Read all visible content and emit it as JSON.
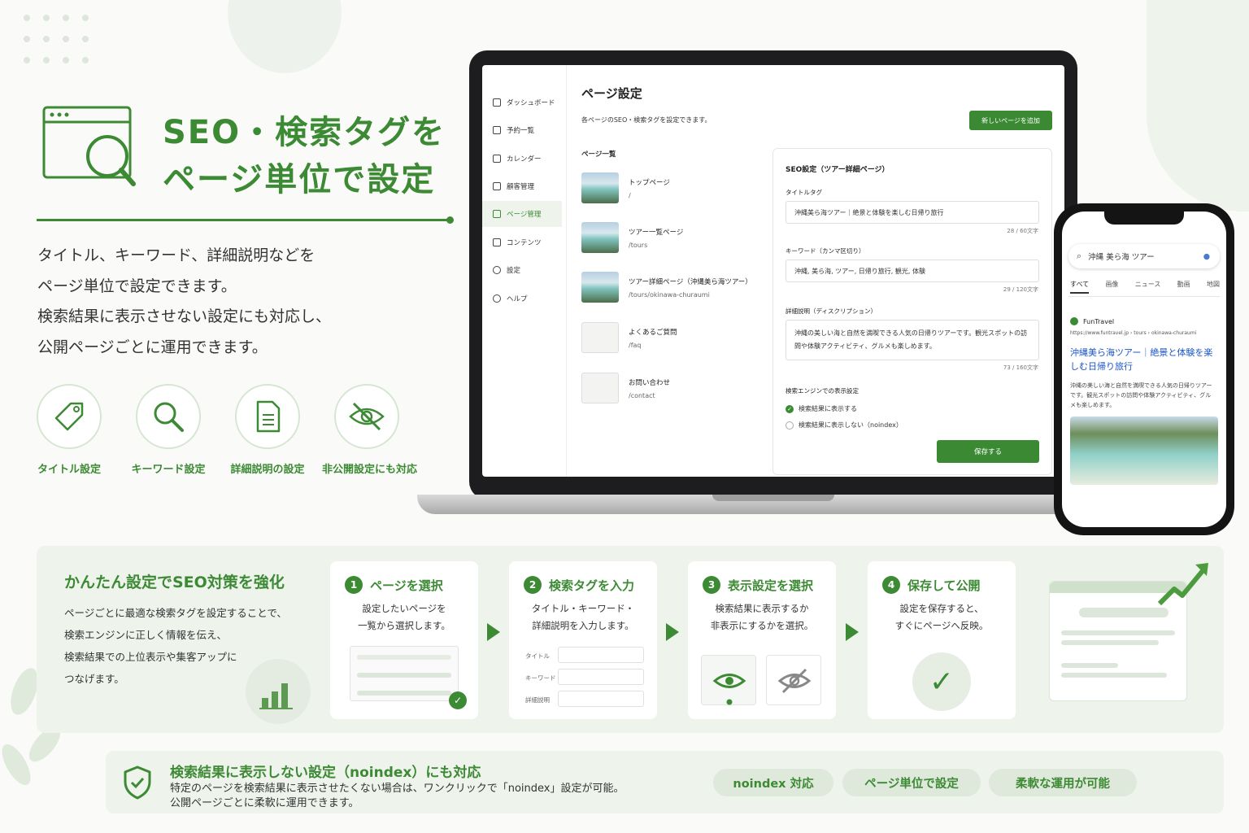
{
  "hero": {
    "title_line1": "SEO・検索タグを",
    "title_line2": "ページ単位で設定",
    "desc": [
      "タイトル、キーワード、詳細説明などを",
      "ページ単位で設定できます。",
      "検索結果に表示させない設定にも対応し、",
      "公開ページごとに運用できます。"
    ]
  },
  "features": [
    {
      "label": "タイトル設定",
      "icon": "tag-icon"
    },
    {
      "label": "キーワード設定",
      "icon": "search-icon"
    },
    {
      "label": "詳細説明の設定",
      "icon": "document-icon"
    },
    {
      "label": "非公開設定にも対応",
      "icon": "eye-off-icon"
    }
  ],
  "app": {
    "sidebar": [
      "ダッシュボード",
      "予約一覧",
      "カレンダー",
      "顧客管理",
      "ページ管理",
      "コンテンツ",
      "設定",
      "ヘルプ"
    ],
    "active": "ページ管理",
    "title": "ページ設定",
    "subtitle": "各ページのSEO・検索タグを設定できます。",
    "new_button": "新しいページを追加",
    "list_heading": "ページ一覧",
    "pages": [
      {
        "name": "トップページ",
        "path": "/"
      },
      {
        "name": "ツアー一覧ページ",
        "path": "/tours"
      },
      {
        "name": "ツアー詳細ページ（沖縄美ら海ツアー）",
        "path": "/tours/okinawa-churaumi"
      },
      {
        "name": "よくあるご質問",
        "path": "/faq"
      },
      {
        "name": "お問い合わせ",
        "path": "/contact"
      }
    ],
    "panel": {
      "heading": "SEO設定（ツアー詳細ページ）",
      "title_label": "タイトルタグ",
      "title_value": "沖縄美ら海ツアー｜絶景と体験を楽しむ日帰り旅行",
      "title_count": "28 / 60文字",
      "kw_label": "キーワード（カンマ区切り）",
      "kw_value": "沖縄, 美ら海, ツアー, 日帰り旅行, 観光, 体験",
      "kw_count": "29 / 120文字",
      "desc_label": "詳細説明（ディスクリプション）",
      "desc_value": "沖縄の美しい海と自然を満喫できる人気の日帰りツアーです。観光スポットの訪問や体験アクティビティ、グルメも楽しめます。",
      "desc_count": "73 / 160文字",
      "display_label": "検索エンジンでの表示設定",
      "opt_show": "検索結果に表示する",
      "opt_hide": "検索結果に表示しない（noindex）",
      "save": "保存する"
    }
  },
  "phone": {
    "query": "沖縄 美ら海 ツアー",
    "tabs": [
      "すべて",
      "画像",
      "ニュース",
      "動画",
      "地図"
    ],
    "site": "FunTravel",
    "url": "https://www.funtravel.jp › tours › okinawa-churaumi",
    "result_title": "沖縄美ら海ツアー｜絶景と体験を楽しむ日帰り旅行",
    "snippet": "沖縄の美しい海と自然を満喫できる人気の日帰りツアーです。観光スポットの訪問や体験アクティビティ、グルメも楽しめます。"
  },
  "bottom": {
    "heading": "かんたん設定でSEO対策を強化",
    "desc": [
      "ページごとに最適な検索タグを設定することで、",
      "検索エンジンに正しく情報を伝え、",
      "検索結果での上位表示や集客アップに",
      "つなげます。"
    ],
    "steps": [
      {
        "num": "1",
        "title": "ページを選択",
        "desc": [
          "設定したいページを",
          "一覧から選択します。"
        ]
      },
      {
        "num": "2",
        "title": "検索タグを入力",
        "desc": [
          "タイトル・キーワード・",
          "詳細説明を入力します。"
        ],
        "fields": [
          "タイトル",
          "キーワード",
          "詳細説明"
        ]
      },
      {
        "num": "3",
        "title": "表示設定を選択",
        "desc": [
          "検索結果に表示するか",
          "非表示にするかを選択。"
        ]
      },
      {
        "num": "4",
        "title": "保存して公開",
        "desc": [
          "設定を保存すると、",
          "すぐにページへ反映。"
        ]
      }
    ]
  },
  "noindex": {
    "title": "検索結果に表示しない設定（noindex）にも対応",
    "desc": [
      "特定のページを検索結果に表示させたくない場合は、ワンクリックで「noindex」設定が可能。",
      "公開ページごとに柔軟に運用できます。"
    ],
    "pills": [
      "noindex 対応",
      "ページ単位で設定",
      "柔軟な運用が可能"
    ]
  },
  "colors": {
    "accent": "#3d8a35",
    "light": "#eef3ec"
  }
}
